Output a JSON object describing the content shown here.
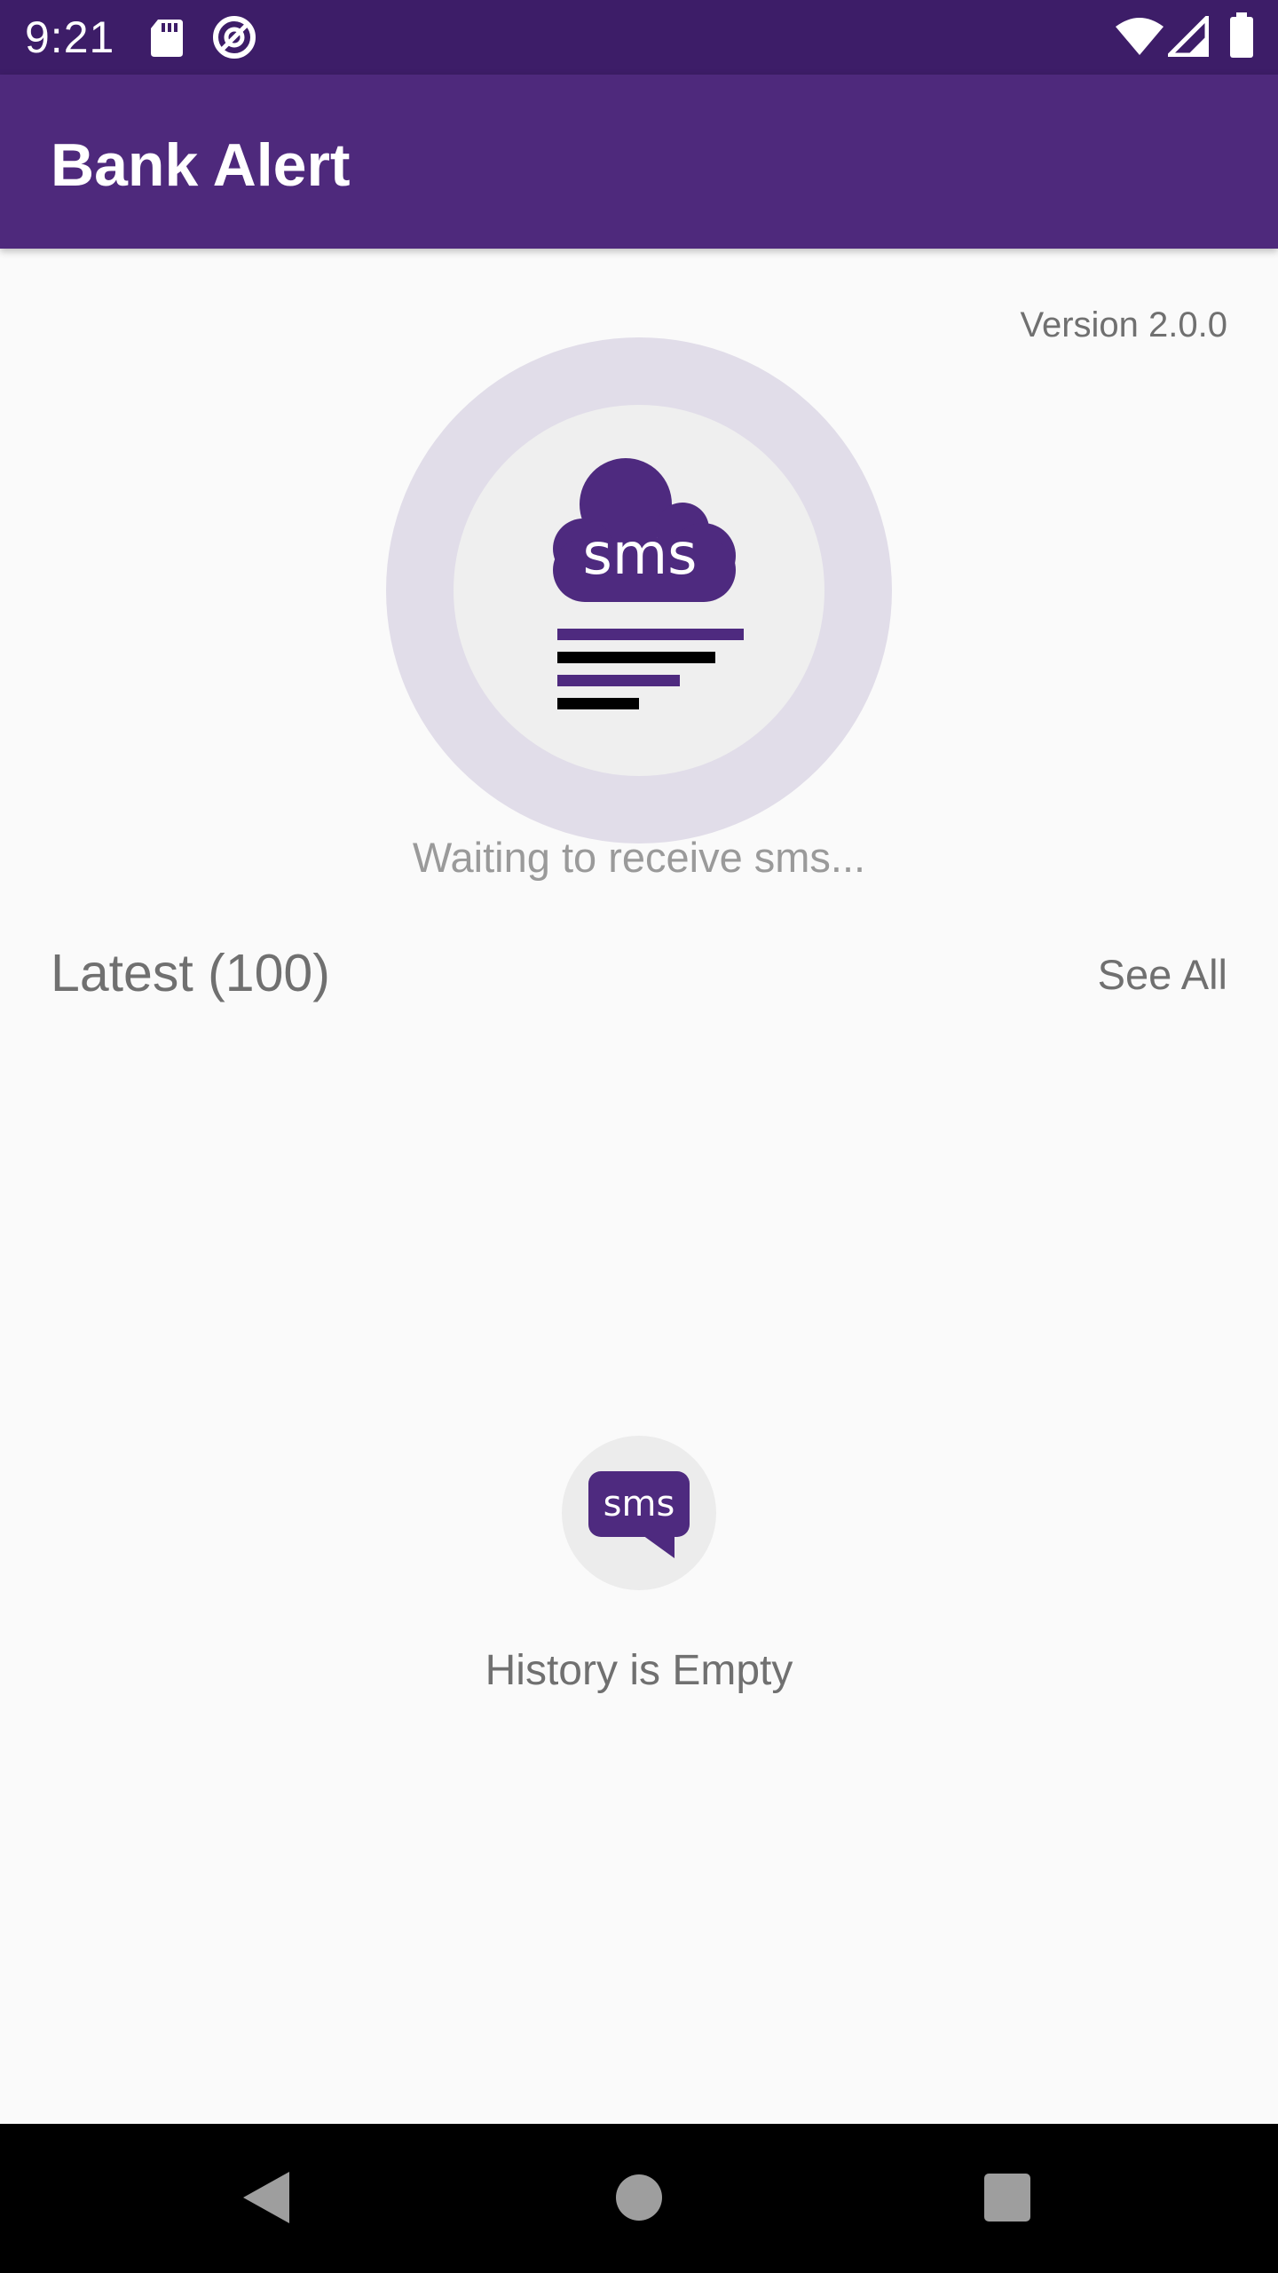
{
  "status_bar": {
    "time": "9:21",
    "icons": [
      "sd-card-icon",
      "data-saver-icon",
      "wifi-icon",
      "signal-icon",
      "battery-icon"
    ]
  },
  "app_bar": {
    "title": "Bank Alert"
  },
  "main": {
    "version": "Version 2.0.0",
    "hero_icon_text": "sms",
    "waiting_text": "Waiting to receive sms...",
    "latest_label": "Latest (100)",
    "see_all_label": "See All",
    "empty_icon_text": "sms",
    "empty_text": "History is Empty"
  },
  "nav_bar": {
    "buttons": [
      "back-icon",
      "home-icon",
      "recents-icon"
    ]
  },
  "colors": {
    "status_bar": "#3d1d68",
    "app_bar": "#4e297c",
    "accent": "#4e2a7f",
    "background": "#fafafa",
    "text_secondary": "#707070"
  }
}
